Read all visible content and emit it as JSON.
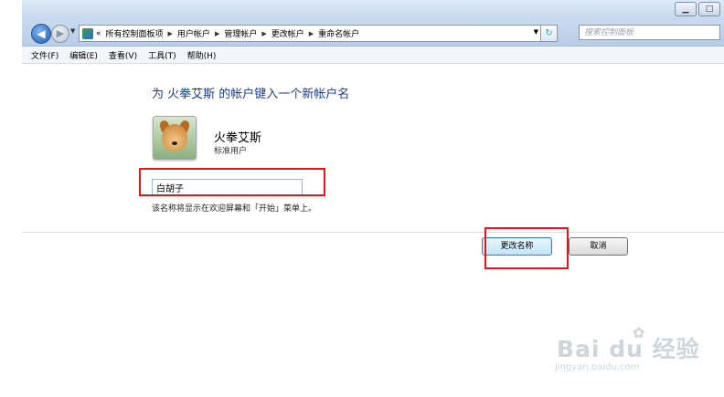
{
  "window": {
    "minimize_icon": "minimize-icon",
    "maximize_icon": "maximize-icon"
  },
  "address_bar": {
    "prefix": "«",
    "breadcrumbs": [
      "所有控制面板项",
      "用户帐户",
      "管理帐户",
      "更改帐户",
      "重命名帐户"
    ],
    "search_placeholder": "搜索控制面板"
  },
  "menu": [
    "文件(F)",
    "编辑(E)",
    "查看(V)",
    "工具(T)",
    "帮助(H)"
  ],
  "page": {
    "heading": "为 火拳艾斯 的帐户键入一个新帐户名",
    "user_name": "火拳艾斯",
    "user_type": "标准用户",
    "new_name_value": "白胡子",
    "hint": "该名称将显示在欢迎屏幕和「开始」菜单上。"
  },
  "buttons": {
    "change_name": "更改名称",
    "cancel": "取消"
  },
  "annotations": {
    "highlight_color": "#e8141b"
  },
  "watermark": {
    "main": "Bai du 经验",
    "sub": "jingyan.baidu.com"
  }
}
